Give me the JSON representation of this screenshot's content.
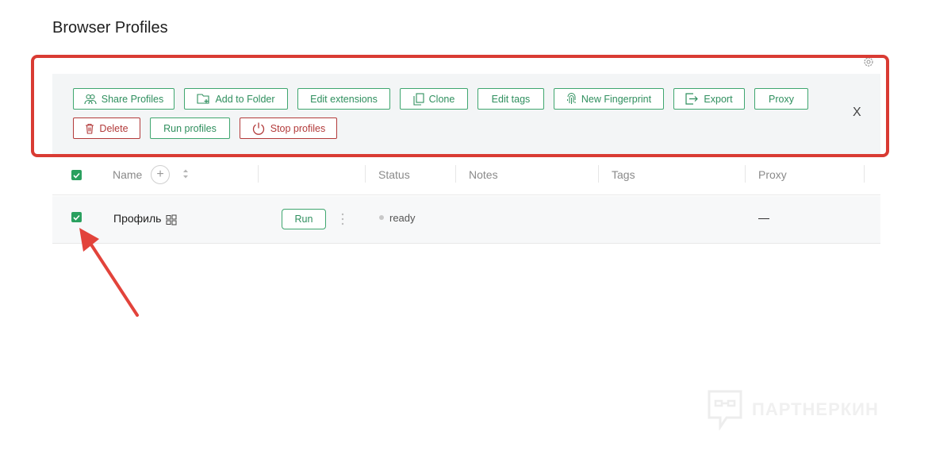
{
  "page": {
    "title": "Browser Profiles"
  },
  "toolbar": {
    "buttons": {
      "share_profiles": "Share Profiles",
      "add_to_folder": "Add to Folder",
      "edit_extensions": "Edit extensions",
      "clone": "Clone",
      "edit_tags": "Edit tags",
      "new_fingerprint": "New Fingerprint",
      "export": "Export",
      "proxy": "Proxy",
      "delete": "Delete",
      "run_profiles": "Run profiles",
      "stop_profiles": "Stop profiles"
    },
    "close": "X"
  },
  "table": {
    "columns": {
      "name": "Name",
      "status": "Status",
      "notes": "Notes",
      "tags": "Tags",
      "proxy": "Proxy"
    },
    "rows": [
      {
        "name": "Профиль",
        "run_label": "Run",
        "status": "ready",
        "notes": "",
        "tags": "",
        "proxy": "—",
        "selected": true
      }
    ],
    "select_all": true
  },
  "watermark": {
    "text": "ПАРТНЕРКИН"
  },
  "colors": {
    "accent": "#2f8f5e",
    "danger": "#b23a3a",
    "highlight": "#d93b33"
  }
}
